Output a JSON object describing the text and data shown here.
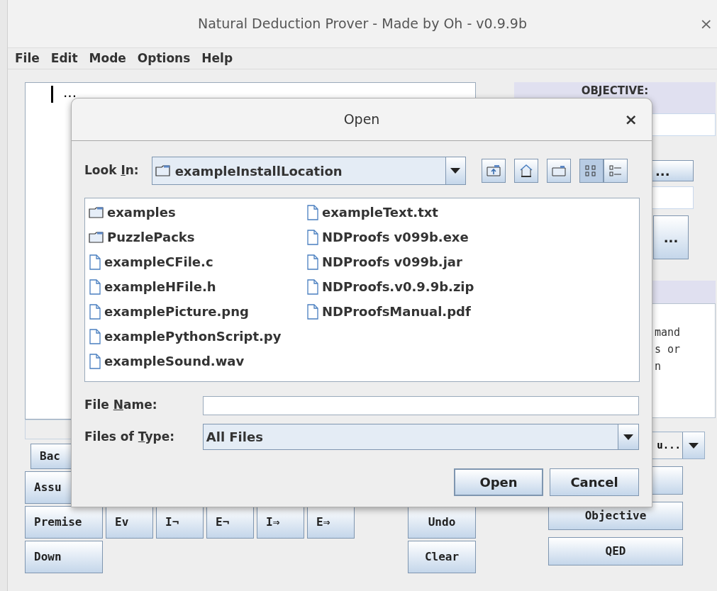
{
  "window": {
    "title": "Natural Deduction Prover - Made by Oh - v0.9.9b",
    "close": "×"
  },
  "menu": [
    "File",
    "Edit",
    "Mode",
    "Options",
    "Help"
  ],
  "proof_editor": {
    "text": "..."
  },
  "left_buttons": [
    [
      "Bac"
    ],
    [
      "Assu"
    ],
    [
      "Premise",
      "Ev",
      "I¬",
      "E¬",
      "I⇒",
      "E⇒"
    ],
    [
      "Down"
    ]
  ],
  "right_side_buttons": [
    "Undo",
    "Clear"
  ],
  "objective": {
    "header": "OBJECTIVE:",
    "button": "...",
    "tall_button": "..."
  },
  "console_lines": [
    "mand",
    "s or",
    "n"
  ],
  "mode_combo": {
    "value": "u..."
  },
  "action_buttons": [
    "Objective",
    "QED"
  ],
  "dialog": {
    "title": "Open",
    "close": "×",
    "look_in": {
      "label_parts": [
        "Look ",
        "I",
        "n:"
      ],
      "value": "exampleInstallLocation"
    },
    "toolbar": [
      {
        "kind": "up",
        "selected": false
      },
      {
        "kind": "home",
        "selected": false
      },
      {
        "kind": "new-folder",
        "selected": false
      },
      {
        "kind": "list",
        "selected": true
      },
      {
        "kind": "details",
        "selected": false
      }
    ],
    "files": [
      {
        "name": "examples",
        "kind": "folder"
      },
      {
        "name": "PuzzlePacks",
        "kind": "folder"
      },
      {
        "name": "exampleCFile.c",
        "kind": "file"
      },
      {
        "name": "exampleHFile.h",
        "kind": "file"
      },
      {
        "name": "examplePicture.png",
        "kind": "file"
      },
      {
        "name": "examplePythonScript.py",
        "kind": "file"
      },
      {
        "name": "exampleSound.wav",
        "kind": "file"
      },
      {
        "name": "exampleText.txt",
        "kind": "file"
      },
      {
        "name": "NDProofs v099b.exe",
        "kind": "file"
      },
      {
        "name": "NDProofs v099b.jar",
        "kind": "file"
      },
      {
        "name": "NDProofs.v0.9.9b.zip",
        "kind": "file"
      },
      {
        "name": "NDProofsManual.pdf",
        "kind": "file"
      }
    ],
    "file_name": {
      "label_parts": [
        "File ",
        "N",
        "ame:"
      ]
    },
    "file_type": {
      "label_parts": [
        "Files of ",
        "T",
        "ype:"
      ],
      "value": "All Files"
    },
    "buttons": [
      "Open",
      "Cancel"
    ]
  }
}
